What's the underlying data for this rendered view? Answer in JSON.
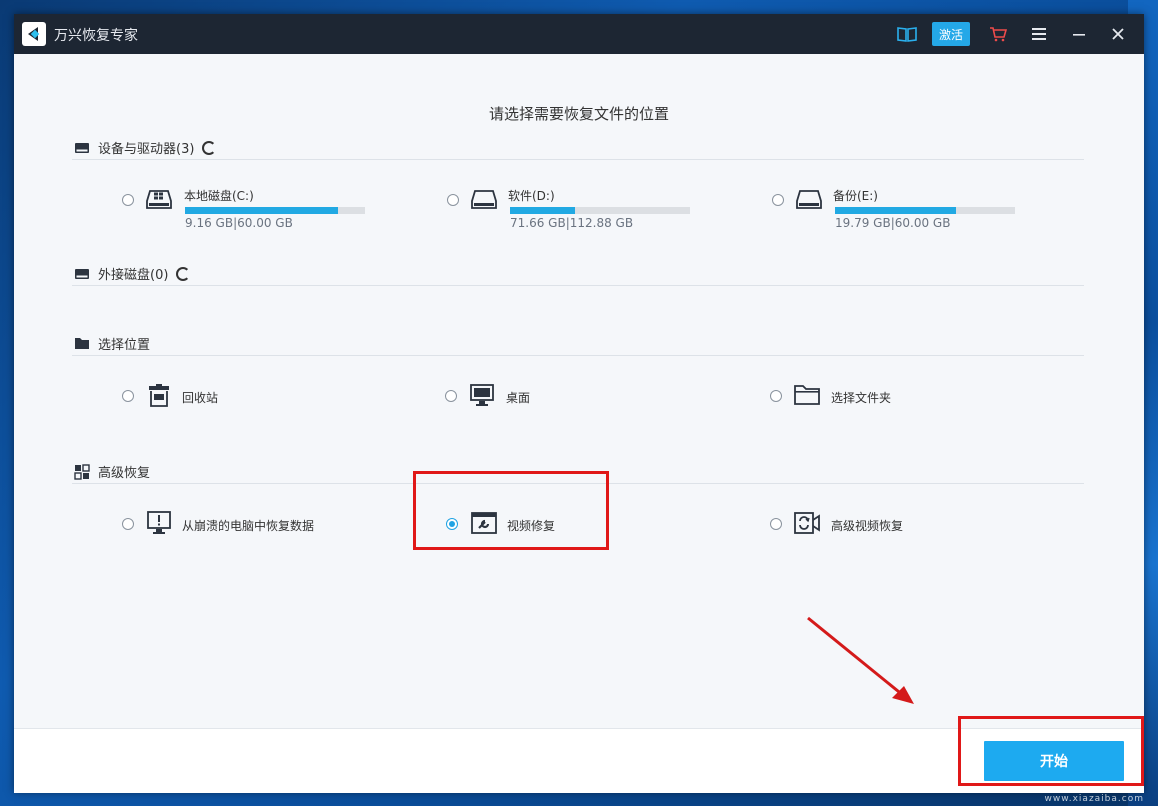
{
  "app": {
    "title": "万兴恢复专家",
    "activate_label": "激活",
    "colors": {
      "titlebar": "#1d2633",
      "accent": "#1daaf0",
      "highlight": "#e01818"
    }
  },
  "heading": "请选择需要恢复文件的位置",
  "sections": {
    "devices": {
      "title": "设备与驱动器(3)",
      "drives": [
        {
          "name": "本地磁盘(C:)",
          "size": "9.16 GB|60.00 GB",
          "used_fraction": 0.85
        },
        {
          "name": "软件(D:)",
          "size": "71.66 GB|112.88 GB",
          "used_fraction": 0.36
        },
        {
          "name": "备份(E:)",
          "size": "19.79 GB|60.00 GB",
          "used_fraction": 0.67
        }
      ]
    },
    "external": {
      "title": "外接磁盘(0)"
    },
    "location": {
      "title": "选择位置",
      "items": [
        {
          "label": "回收站",
          "icon": "recycle-bin-icon"
        },
        {
          "label": "桌面",
          "icon": "desktop-icon"
        },
        {
          "label": "选择文件夹",
          "icon": "folder-icon"
        }
      ]
    },
    "advanced": {
      "title": "高级恢复",
      "items": [
        {
          "label": "从崩溃的电脑中恢复数据",
          "icon": "crashed-pc-icon",
          "selected": false
        },
        {
          "label": "视频修复",
          "icon": "video-repair-icon",
          "selected": true
        },
        {
          "label": "高级视频恢复",
          "icon": "advanced-video-icon",
          "selected": false
        }
      ]
    }
  },
  "footer": {
    "start_label": "开始"
  },
  "watermark": "www.xiazaiba.com"
}
